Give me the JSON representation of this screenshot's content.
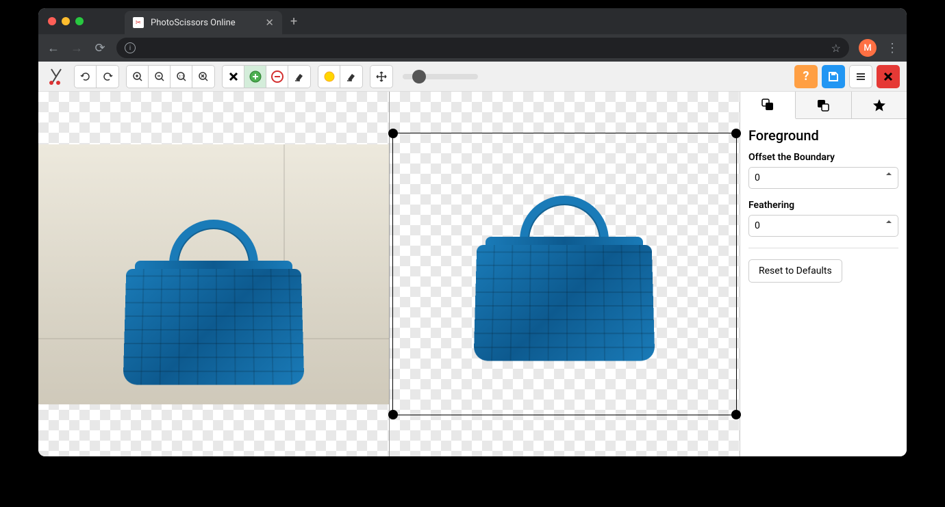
{
  "window": {
    "tab_title": "PhotoScissors Online",
    "avatar_letter": "M"
  },
  "toolbar": {
    "icons": {
      "undo": "undo-icon",
      "redo": "redo-icon",
      "zoom_in": "zoom-in-icon",
      "zoom_out": "zoom-out-icon",
      "zoom_fit": "zoom-fit-icon",
      "zoom_actual": "zoom-actual-icon",
      "clear_marks": "x-icon",
      "fg_mark": "plus-circle-icon",
      "bg_mark": "minus-circle-icon",
      "fg_erase": "eraser-icon",
      "highlight": "highlight-marker-icon",
      "hl_erase": "eraser-icon",
      "pan": "move-icon"
    }
  },
  "actions": {
    "help": "?",
    "save": "save-icon",
    "menu": "menu-icon",
    "close": "✕"
  },
  "sidebar": {
    "title": "Foreground",
    "offset_label": "Offset the Boundary",
    "offset_value": "0",
    "feather_label": "Feathering",
    "feather_value": "0",
    "reset_label": "Reset to Defaults"
  }
}
